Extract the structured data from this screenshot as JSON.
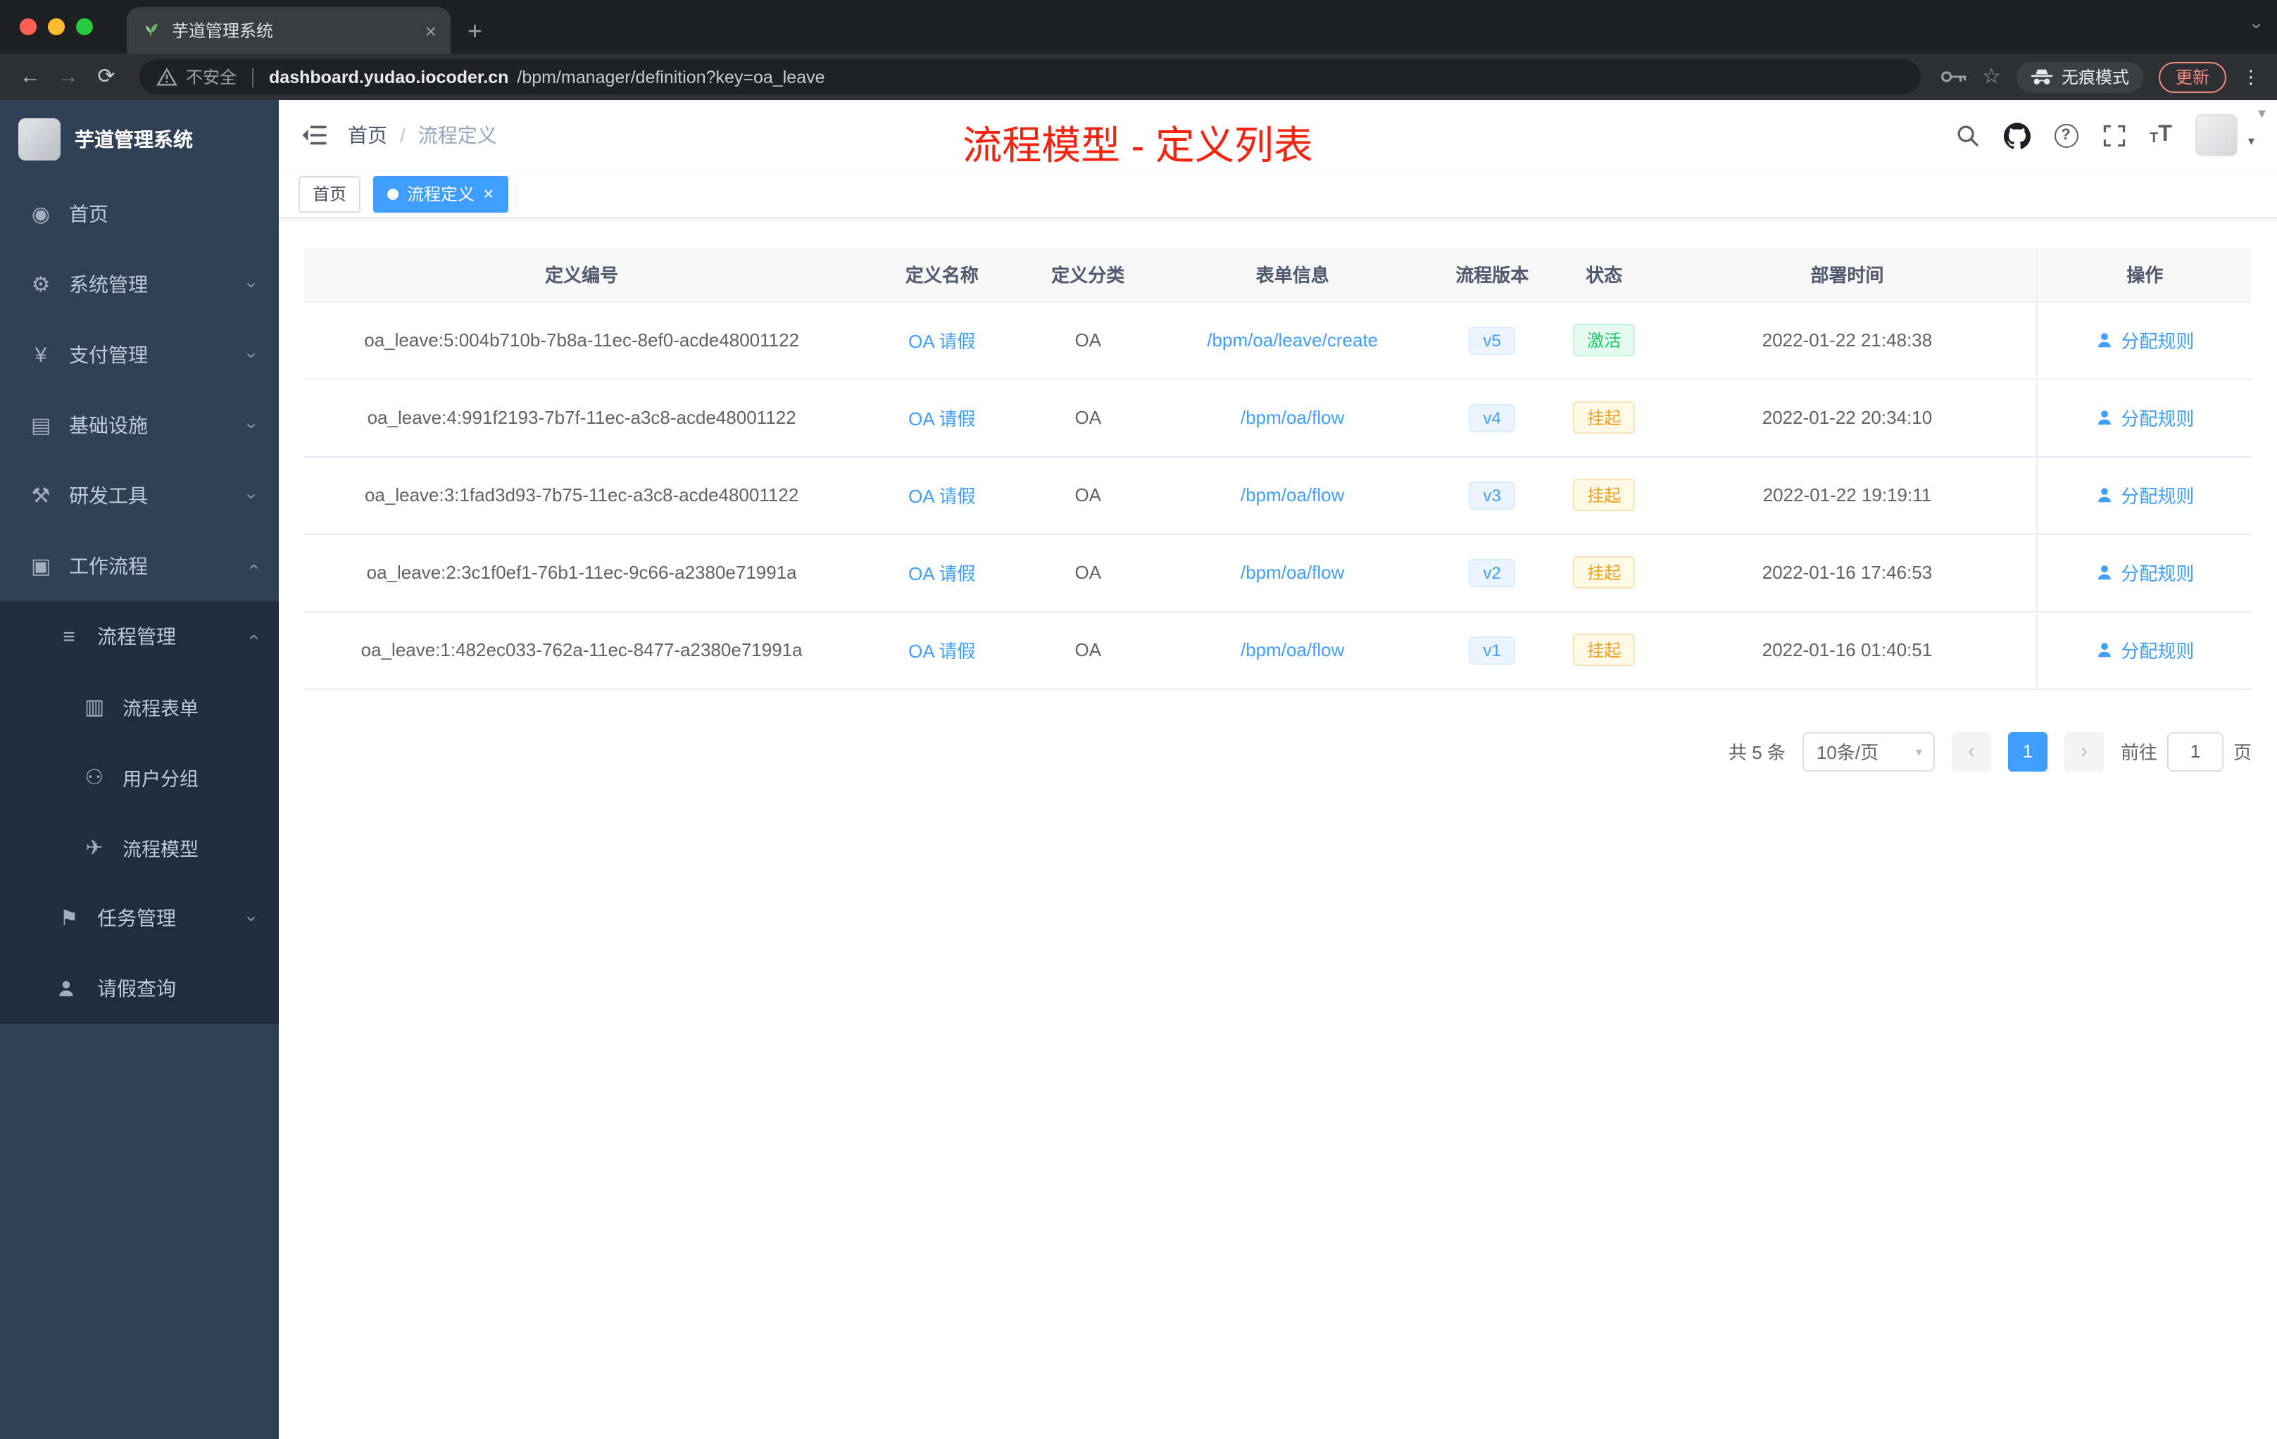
{
  "theme": {
    "accent": "#409eff",
    "annotation_red": "#f62311",
    "sidebar_bg": "#304156",
    "sidebar_sub_bg": "#1f2d3d",
    "success_green": "#13ce66",
    "warning_orange": "#f0a020"
  },
  "icons": {
    "close": "×",
    "plus": "+",
    "back": "←",
    "forward": "→",
    "refresh": "⟳",
    "star": "☆",
    "kebab": "⋮",
    "chevron": "›",
    "caret_down": "▾",
    "help": "?",
    "prev": "‹",
    "next": "›",
    "home": "◉",
    "system": "⚙",
    "payment": "¥",
    "infra": "▤",
    "devtools": "⚒",
    "workflow": "▣",
    "process_mgmt": "≡",
    "process_form": "▥",
    "user_group": "⚇",
    "process_model": "✈",
    "task_mgmt": "⚑",
    "font_small": "T",
    "font_big": "T"
  },
  "browser": {
    "tab_title": "芋道管理系统",
    "security_label": "不安全",
    "url_host": "dashboard.yudao.iocoder.cn",
    "url_path": "/bpm/manager/definition?key=oa_leave",
    "incognito_label": "无痕模式",
    "update_label": "更新"
  },
  "sidebar": {
    "logo_title": "芋道管理系统",
    "home": "首页",
    "system": "系统管理",
    "payment": "支付管理",
    "infra": "基础设施",
    "devtools": "研发工具",
    "workflow": "工作流程",
    "process_mgmt": "流程管理",
    "process_form": "流程表单",
    "user_group": "用户分组",
    "process_model": "流程模型",
    "task_mgmt": "任务管理",
    "leave_query": "请假查询"
  },
  "topbar": {
    "breadcrumb_home": "首页",
    "breadcrumb_sep": "/",
    "breadcrumb_current": "流程定义",
    "annotation": "流程模型 - 定义列表"
  },
  "tags": {
    "home": "首页",
    "active": "流程定义"
  },
  "table": {
    "columns": [
      "定义编号",
      "定义名称",
      "定义分类",
      "表单信息",
      "流程版本",
      "状态",
      "部署时间",
      "操作"
    ],
    "rows": [
      {
        "id": "oa_leave:5:004b710b-7b8a-11ec-8ef0-acde48001122",
        "name": "OA 请假",
        "category": "OA",
        "form": "/bpm/oa/leave/create",
        "version": "v5",
        "status": "激活",
        "status_type": "active",
        "time": "2022-01-22 21:48:38",
        "action": "分配规则"
      },
      {
        "id": "oa_leave:4:991f2193-7b7f-11ec-a3c8-acde48001122",
        "name": "OA 请假",
        "category": "OA",
        "form": "/bpm/oa/flow",
        "version": "v4",
        "status": "挂起",
        "status_type": "suspended",
        "time": "2022-01-22 20:34:10",
        "action": "分配规则"
      },
      {
        "id": "oa_leave:3:1fad3d93-7b75-11ec-a3c8-acde48001122",
        "name": "OA 请假",
        "category": "OA",
        "form": "/bpm/oa/flow",
        "version": "v3",
        "status": "挂起",
        "status_type": "suspended",
        "time": "2022-01-22 19:19:11",
        "action": "分配规则"
      },
      {
        "id": "oa_leave:2:3c1f0ef1-76b1-11ec-9c66-a2380e71991a",
        "name": "OA 请假",
        "category": "OA",
        "form": "/bpm/oa/flow",
        "version": "v2",
        "status": "挂起",
        "status_type": "suspended",
        "time": "2022-01-16 17:46:53",
        "action": "分配规则"
      },
      {
        "id": "oa_leave:1:482ec033-762a-11ec-8477-a2380e71991a",
        "name": "OA 请假",
        "category": "OA",
        "form": "/bpm/oa/flow",
        "version": "v1",
        "status": "挂起",
        "status_type": "suspended",
        "time": "2022-01-16 01:40:51",
        "action": "分配规则"
      }
    ]
  },
  "pagination": {
    "total": "共 5 条",
    "page_size": "10条/页",
    "page": "1",
    "goto_label": "前往",
    "goto_value": "1",
    "unit_label": "页"
  }
}
